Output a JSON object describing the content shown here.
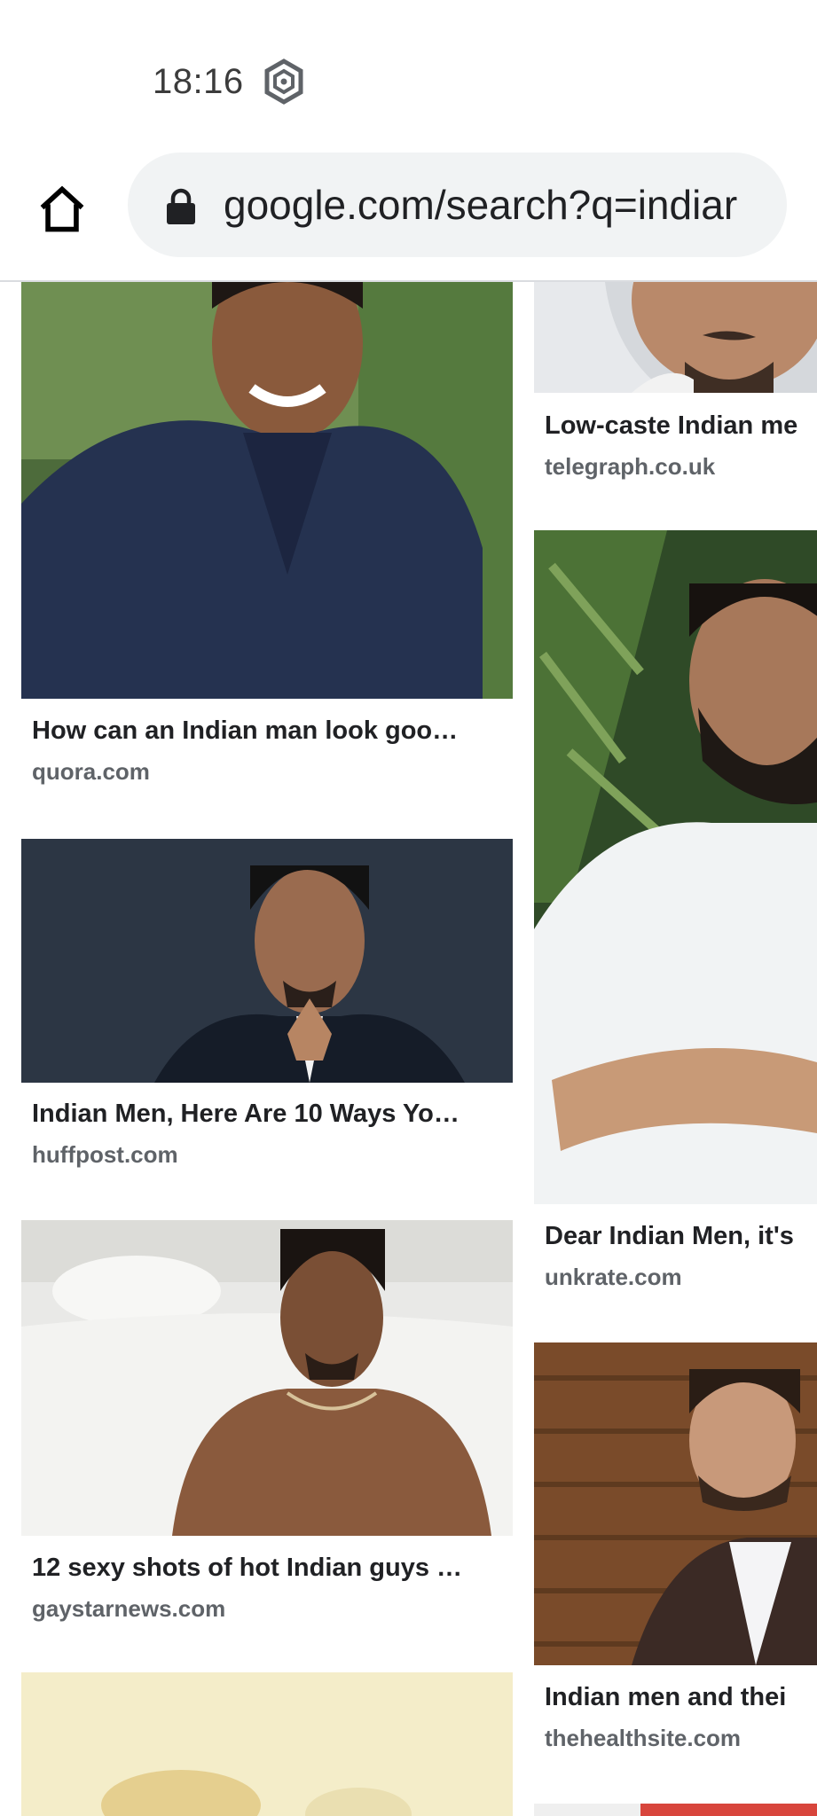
{
  "status_bar": {
    "time": "18:16",
    "icon": "hexagon-settings-icon"
  },
  "toolbar": {
    "home_icon": "home-icon",
    "lock_icon": "lock-icon",
    "url": "google.com/search?q=indiar"
  },
  "results": {
    "left_column": [
      {
        "title": "How can an Indian man look goo…",
        "source": "quora.com"
      },
      {
        "title": "Indian Men, Here Are 10 Ways Yo…",
        "source": "huffpost.com"
      },
      {
        "title": "12 sexy shots of hot Indian guys …",
        "source": "gaystarnews.com"
      }
    ],
    "right_column": [
      {
        "title": "Low-caste Indian me",
        "source": "telegraph.co.uk"
      },
      {
        "title": "Dear Indian Men, it's",
        "source": "unkrate.com"
      },
      {
        "title": "Indian men and thei",
        "source": "thehealthsite.com"
      }
    ]
  }
}
